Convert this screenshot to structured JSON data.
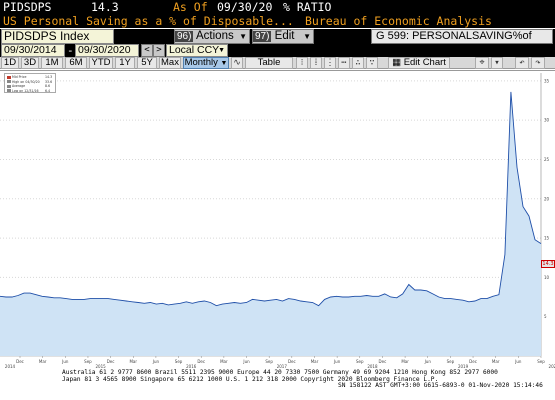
{
  "header": {
    "ticker": "PIDSDPS",
    "last_value": "14.3",
    "asof_label": "As Of",
    "asof_date": "09/30/20",
    "unit": "% RATIO",
    "description": "US Personal Saving as a % of Disposable...",
    "source": "Bureau of Economic Analysis"
  },
  "toolbar": {
    "security": "PIDSDPS Index",
    "actions_num": "96)",
    "actions_label": "Actions",
    "edit_num": "97)",
    "edit_label": "Edit",
    "sec_title": "G 599: PERSONALSAVING%of",
    "start_date": "09/30/2014",
    "end_date": "09/30/2020",
    "date_sep": "-",
    "nav_prev": "<",
    "nav_next": ">",
    "currency": "Local CCY"
  },
  "periods": {
    "items": [
      "1D",
      "3D",
      "1M",
      "6M",
      "YTD",
      "1Y",
      "5Y",
      "Max"
    ],
    "frequency": "Monthly",
    "table": "Table",
    "edit_chart": "Edit Chart"
  },
  "legend": {
    "items": [
      {
        "label": "Mid Price",
        "value": "14.3",
        "color": "#c0392b"
      },
      {
        "label": "High on 04/30/20",
        "value": "33.6",
        "color": "#888888"
      },
      {
        "label": "Average",
        "value": "8.6",
        "color": "#888888"
      },
      {
        "label": "Low on 12/31/16",
        "value": "6.4",
        "color": "#888888"
      }
    ]
  },
  "last_badge": "14.3",
  "chart_data": {
    "type": "area",
    "ylim": [
      0,
      36
    ],
    "y_ticks": [
      5,
      10,
      15,
      20,
      25,
      30,
      35
    ],
    "x_tick_labels": [
      "Dec",
      "Mar",
      "Jun",
      "Sep",
      "Dec",
      "Mar",
      "Jun",
      "Sep",
      "Dec",
      "Mar",
      "Jun",
      "Sep",
      "Dec",
      "Mar",
      "Jun",
      "Sep",
      "Dec",
      "Mar",
      "Jun",
      "Sep",
      "Dec",
      "Mar",
      "Jun",
      "Sep"
    ],
    "year_labels": [
      "2014",
      "2015",
      "2016",
      "2017",
      "2018",
      "2019",
      "2020"
    ],
    "series": [
      {
        "name": "Mid Price",
        "color": "#1f4fa8",
        "fill": "#cfe3f5",
        "values": [
          7.6,
          7.5,
          7.5,
          7.7,
          8.0,
          8.0,
          7.8,
          7.6,
          7.5,
          7.4,
          7.4,
          7.3,
          7.2,
          7.2,
          7.2,
          7.3,
          7.3,
          7.3,
          7.3,
          7.2,
          7.1,
          7.0,
          6.9,
          6.8,
          6.7,
          6.8,
          6.6,
          6.7,
          6.5,
          6.6,
          6.7,
          6.9,
          6.7,
          6.9,
          7.0,
          6.8,
          6.4,
          6.6,
          6.7,
          6.8,
          6.7,
          6.8,
          7.2,
          7.1,
          7.0,
          7.1,
          7.2,
          7.0,
          7.3,
          7.2,
          7.0,
          6.9,
          6.8,
          6.4,
          7.2,
          7.5,
          7.6,
          7.5,
          7.5,
          7.6,
          7.6,
          7.7,
          7.6,
          7.6,
          7.9,
          7.5,
          7.4,
          7.9,
          9.1,
          8.4,
          8.4,
          8.3,
          7.9,
          7.5,
          7.3,
          7.3,
          7.2,
          7.1,
          6.9,
          7.0,
          7.3,
          7.3,
          7.6,
          7.8,
          12.9,
          33.6,
          24.0,
          19.0,
          17.8,
          14.8,
          14.3
        ]
      }
    ]
  },
  "footer": {
    "line1": "Australia 61 2 9777 8600  Brazil 5511 2395 9000  Europe 44 20 7330 7500  Germany 49 69 9204 1210  Hong Kong 852 2977 6000",
    "line2": "Japan 81 3 4565 8900        Singapore 65 6212 1000        U.S. 1 212 318 2000       Copyright 2020 Bloomberg Finance L.P.",
    "line3": "SN 158122 AST  GMT+3:00 G615-6893-0 01-Nov-2020 15:14:46"
  }
}
